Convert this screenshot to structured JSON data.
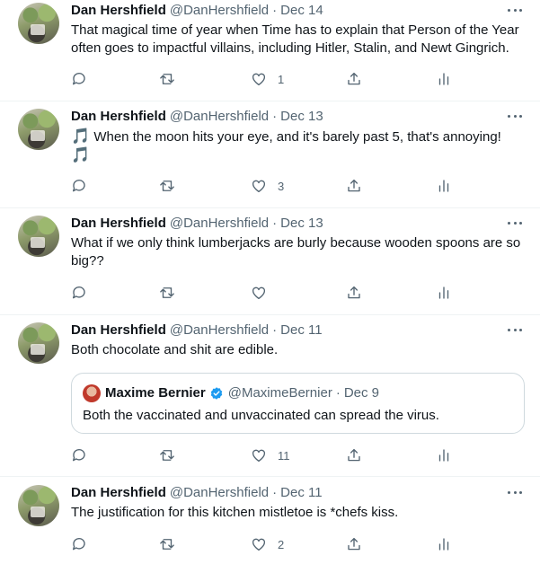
{
  "tweets": [
    {
      "name": "Dan Hershfield",
      "handle": "@DanHershfield",
      "date": "Dec 14",
      "text": "That magical time of year when Time has to explain that Person of the Year often goes to impactful villains, including Hitler, Stalin, and Newt Gingrich.",
      "likes": "1"
    },
    {
      "name": "Dan Hershfield",
      "handle": "@DanHershfield",
      "date": "Dec 13",
      "text_note_1": "🎵",
      "text_main": " When the moon hits your eye, and it's barely past 5, that's annoying!",
      "text_note_2": "🎵",
      "likes": "3"
    },
    {
      "name": "Dan Hershfield",
      "handle": "@DanHershfield",
      "date": "Dec 13",
      "text": "What if we only think lumberjacks are burly because wooden spoons are so big??",
      "likes": ""
    },
    {
      "name": "Dan Hershfield",
      "handle": "@DanHershfield",
      "date": "Dec 11",
      "text": "Both chocolate and shit are edible.",
      "quote": {
        "name": "Maxime Bernier",
        "handle": "@MaximeBernier",
        "date": "Dec 9",
        "text": "Both the vaccinated and unvaccinated can spread the virus."
      },
      "likes": "11"
    },
    {
      "name": "Dan Hershfield",
      "handle": "@DanHershfield",
      "date": "Dec 11",
      "text": "The justification for this kitchen mistletoe is *chefs kiss.",
      "likes": "2"
    }
  ],
  "separator": "·",
  "icons": {
    "reply": "reply-icon",
    "retweet": "retweet-icon",
    "like": "like-icon",
    "share": "share-icon",
    "analytics": "analytics-icon",
    "more": "more-icon",
    "verified": "verified-badge-icon"
  },
  "colors": {
    "text": "#0f1419",
    "secondary": "#536471",
    "accent": "#1d9bf0",
    "border": "#eff3f4"
  }
}
